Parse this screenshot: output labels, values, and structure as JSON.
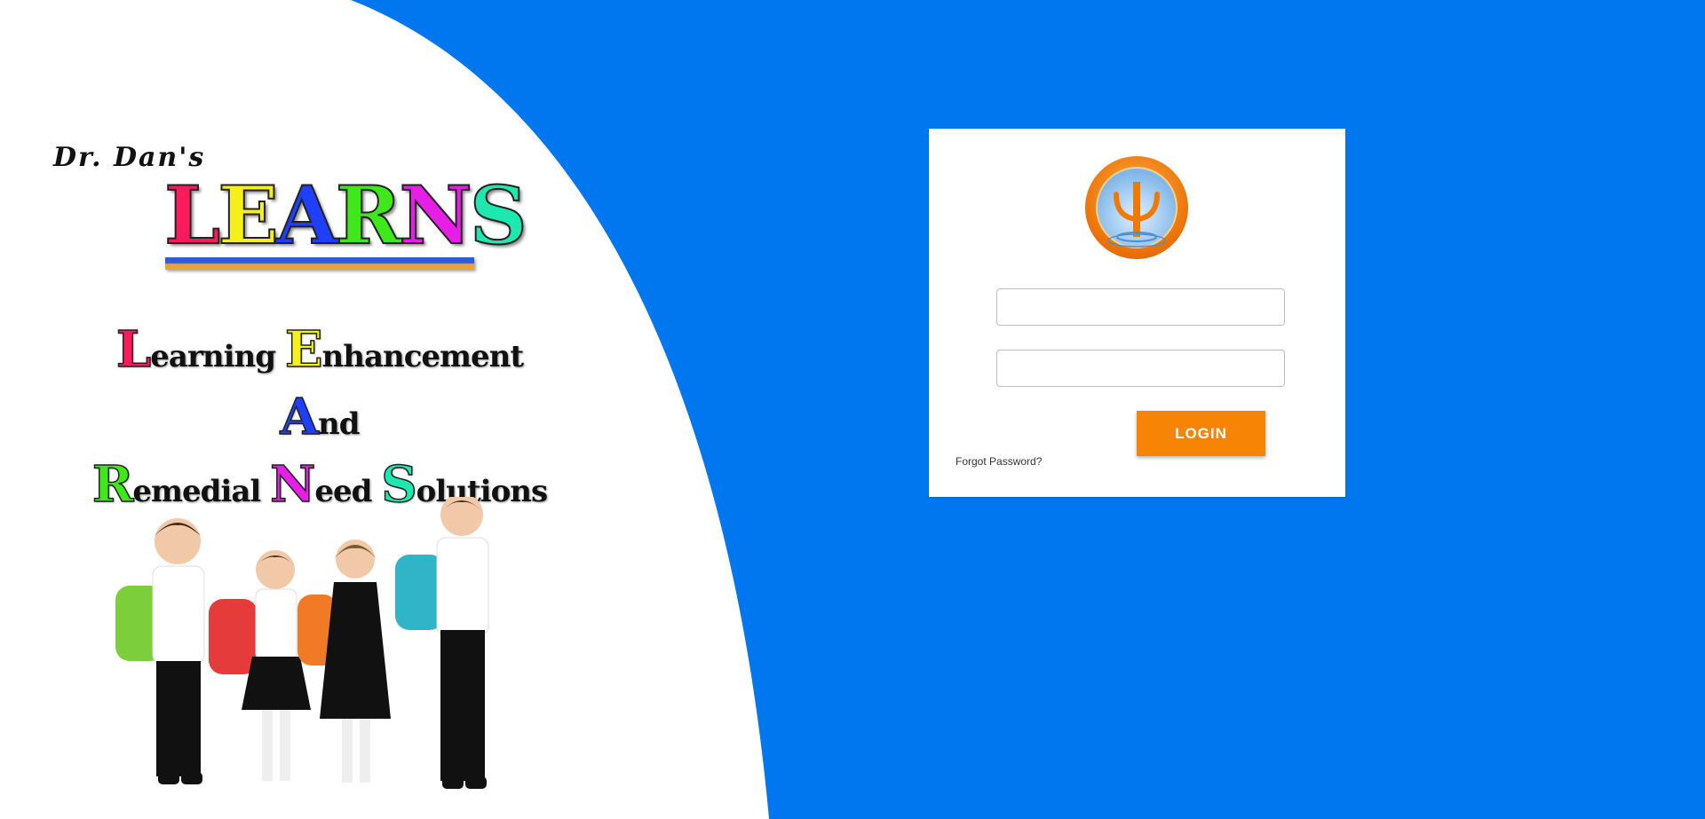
{
  "brand": {
    "signature": "Dr. Dan's",
    "title_letters": [
      {
        "char": "L",
        "color": "#ff1a5e"
      },
      {
        "char": "E",
        "color": "#f5ef1a"
      },
      {
        "char": "A",
        "color": "#1f3fff"
      },
      {
        "char": "R",
        "color": "#3ee81a"
      },
      {
        "char": "N",
        "color": "#e61ee6"
      },
      {
        "char": "S",
        "color": "#1ee8b0"
      }
    ],
    "acronym": [
      [
        {
          "cap": "L",
          "rest": "earning ",
          "color": "#ff1a5e"
        },
        {
          "cap": "E",
          "rest": "nhancement",
          "color": "#f5ef1a"
        }
      ],
      [
        {
          "cap": "A",
          "rest": "nd",
          "color": "#1f3fff"
        }
      ],
      [
        {
          "cap": "R",
          "rest": "emedial ",
          "color": "#3ee81a"
        },
        {
          "cap": "N",
          "rest": "eed ",
          "color": "#e61ee6"
        },
        {
          "cap": "S",
          "rest": "olutions",
          "color": "#1ee8b0"
        }
      ]
    ]
  },
  "login": {
    "username_value": "",
    "password_value": "",
    "button_label": "LOGIN",
    "forgot_password": "Forgot Password?"
  },
  "colors": {
    "background": "#0077ee",
    "accent": "#f78405",
    "card": "#ffffff"
  }
}
